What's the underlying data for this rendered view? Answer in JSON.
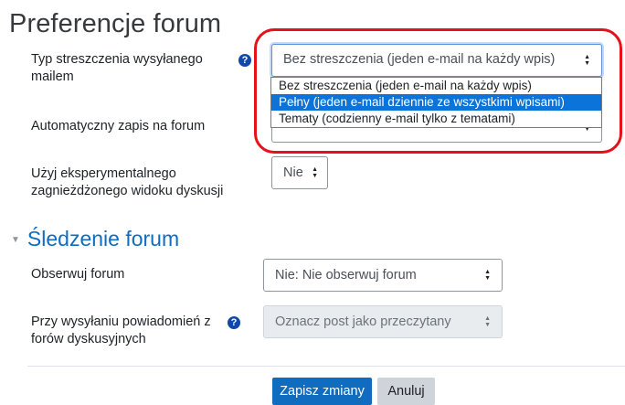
{
  "page": {
    "title": "Preferencje forum"
  },
  "digest": {
    "label_line1": "Typ streszczenia wysyłanego",
    "label_line2": "mailem",
    "selected": "Bez streszczenia (jeden e-mail na każdy wpis)",
    "options": [
      "Bez streszczenia (jeden e-mail na każdy wpis)",
      "Pełny (jeden e-mail dziennie ze wszystkimi wpisami)",
      "Tematy (codzienny e-mail tylko z tematami)"
    ],
    "highlighted_option_index": 1
  },
  "autosubscribe": {
    "label": "Automatyczny zapis na forum"
  },
  "nested_view": {
    "label_line1": "Użyj eksperymentalnego",
    "label_line2": "zagnieżdżonego widoku dyskusji",
    "selected": "Nie"
  },
  "tracking_section": {
    "title": "Śledzenie forum"
  },
  "track_forums": {
    "label": "Obserwuj forum",
    "selected": "Nie: Nie obserwuj forum"
  },
  "mark_read": {
    "label_line1": "Przy wysyłaniu powiadomień z",
    "label_line2": "forów dyskusyjnych",
    "selected": "Oznacz post jako przeczytany"
  },
  "buttons": {
    "save": "Zapisz zmiany",
    "cancel": "Anuluj"
  },
  "icons": {
    "help": "help-icon",
    "caret": "select-caret-icon",
    "collapse": "collapse-triangle-icon"
  },
  "colors": {
    "primary": "#0f6cbf",
    "focus_ring": "#5b8fe0",
    "option_highlight": "#0a74da",
    "annotation_red": "#e5121b",
    "help_icon": "#0f47ad"
  }
}
